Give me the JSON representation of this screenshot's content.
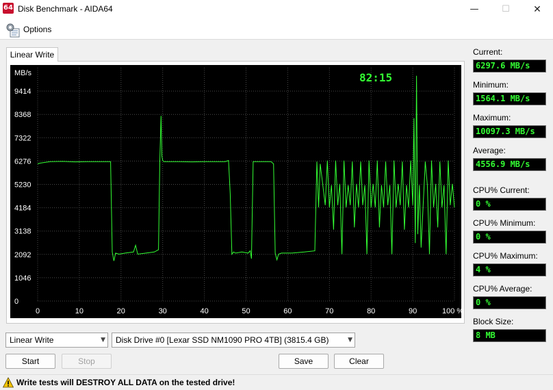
{
  "window": {
    "app_icon_text": "64",
    "title": "Disk Benchmark - AIDA64",
    "minimize_glyph": "—",
    "maximize_glyph": "☐",
    "close_glyph": "✕"
  },
  "menu": {
    "options_label": "Options",
    "options_icon": "options-gear-icon"
  },
  "tab": {
    "label": "Linear Write"
  },
  "chart": {
    "elapsed": "82:15",
    "line_color": "#33ff33",
    "grid_color": "#4a4a4a",
    "text_color": "#ffffff",
    "timer_color": "#33ff33"
  },
  "chart_data": {
    "type": "line",
    "ylabel": "MB/s",
    "ylim": [
      0,
      10460
    ],
    "y_ticks": [
      0,
      1046,
      2092,
      3138,
      4184,
      5230,
      6276,
      7322,
      8368,
      9414
    ],
    "y_tick_labels": [
      "0",
      "1046",
      "2092",
      "3138",
      "4184",
      "5230",
      "6276",
      "7322",
      "8368",
      "9414"
    ],
    "xlim": [
      0,
      100
    ],
    "x_ticks": [
      0,
      10,
      20,
      30,
      40,
      50,
      60,
      70,
      80,
      90,
      100
    ],
    "x_tick_labels": [
      "0",
      "10",
      "20",
      "30",
      "40",
      "50",
      "60",
      "70",
      "80",
      "90",
      "100 %"
    ],
    "grid": true,
    "series": [
      {
        "values_x": [
          0,
          0.5,
          3,
          6,
          9,
          12,
          15,
          17.5,
          17.9,
          18.3,
          18.7,
          19.5,
          21,
          23,
          23.5,
          24,
          26,
          28,
          29,
          29.3,
          29.6,
          29.8,
          30,
          30.3,
          31,
          34,
          37,
          40,
          43,
          45,
          45.8,
          46.2,
          46.6,
          47,
          47.5,
          49,
          50.5,
          51,
          51.3,
          51.7,
          52.5,
          54,
          56,
          56.6,
          57,
          57.4,
          57.8,
          58.5,
          61,
          64,
          66.5,
          67,
          67.4,
          67.8,
          69,
          69.5,
          70,
          70.5,
          71,
          71.5,
          72,
          72.5,
          73,
          73.5,
          74,
          74.5,
          75,
          75.5,
          76,
          76.5,
          77,
          77.5,
          78,
          78.5,
          79,
          79.5,
          80,
          80.5,
          81,
          81.5,
          82,
          82.5,
          83,
          83.5,
          84,
          84.5,
          85,
          85.5,
          86,
          86.5,
          87,
          87.5,
          88,
          88.5,
          89,
          89.5,
          90,
          90.3,
          90.6,
          90.9,
          91.2,
          91.6,
          92,
          92.5,
          93,
          93.5,
          94,
          94.5,
          95,
          95.5,
          96,
          96.5,
          97,
          97.5,
          98,
          98.5,
          99,
          99.5,
          100
        ],
        "values_y": [
          6150,
          6180,
          6250,
          6260,
          6240,
          6250,
          6250,
          6250,
          2200,
          1800,
          2150,
          2100,
          2150,
          2200,
          2500,
          2100,
          2150,
          2200,
          2300,
          6150,
          8300,
          6500,
          6300,
          6250,
          6250,
          6250,
          6240,
          6250,
          6250,
          6250,
          6300,
          4800,
          2100,
          2200,
          2150,
          2200,
          2150,
          2250,
          1900,
          6250,
          6250,
          6250,
          6250,
          6150,
          2150,
          1850,
          2100,
          2150,
          2150,
          2200,
          2250,
          6250,
          4200,
          6150,
          4300,
          6300,
          4200,
          5200,
          3200,
          6300,
          4300,
          5250,
          2100,
          6300,
          4200,
          5200,
          4300,
          6250,
          3300,
          5250,
          4200,
          6250,
          4300,
          5200,
          2100,
          6300,
          4200,
          5250,
          4200,
          6300,
          3300,
          5200,
          4200,
          6250,
          4300,
          5200,
          2100,
          6300,
          4200,
          5250,
          4300,
          6250,
          3200,
          5200,
          4200,
          6300,
          4300,
          8200,
          2600,
          10097,
          3000,
          5200,
          2400,
          4300,
          6250,
          5200,
          2100,
          6300,
          4200,
          5250,
          3300,
          6250,
          4200,
          5200,
          2100,
          6300,
          4300,
          5250,
          4200
        ]
      }
    ]
  },
  "side": {
    "current_label": "Current:",
    "current_value": "6297.6 MB/s",
    "minimum_label": "Minimum:",
    "minimum_value": "1564.1 MB/s",
    "maximum_label": "Maximum:",
    "maximum_value": "10097.3 MB/s",
    "average_label": "Average:",
    "average_value": "4556.9 MB/s",
    "cpu_current_label": "CPU% Current:",
    "cpu_current_value": "0 %",
    "cpu_minimum_label": "CPU% Minimum:",
    "cpu_minimum_value": "0 %",
    "cpu_maximum_label": "CPU% Maximum:",
    "cpu_maximum_value": "4 %",
    "cpu_average_label": "CPU% Average:",
    "cpu_average_value": "0 %",
    "block_size_label": "Block Size:",
    "block_size_value": "8 MB"
  },
  "controls": {
    "test_select": "Linear Write",
    "drive_select": "Disk Drive #0  [Lexar SSD NM1090 PRO 4TB]  (3815.4 GB)",
    "dropdown_glyph": "▼",
    "start_label": "Start",
    "stop_label": "Stop",
    "save_label": "Save",
    "clear_label": "Clear"
  },
  "status": {
    "warning_text": "Write tests will DESTROY ALL DATA on the tested drive!",
    "warning_color": "#f5c400"
  }
}
